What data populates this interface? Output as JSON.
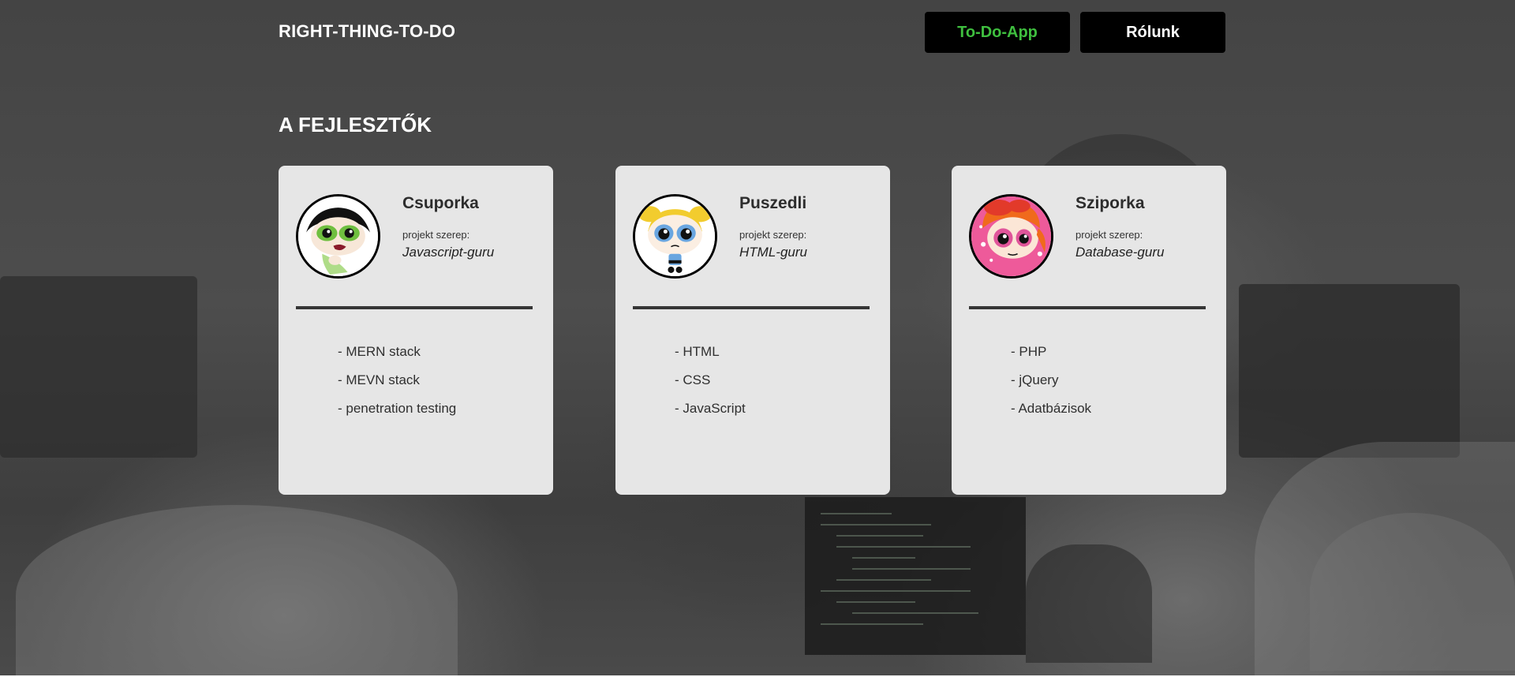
{
  "header": {
    "brand": "RIGHT-THING-TO-DO",
    "nav": [
      {
        "label": "To-Do-App",
        "color": "#3fbf3f"
      },
      {
        "label": "Rólunk",
        "color": "#ffffff"
      }
    ]
  },
  "section": {
    "title": "A FEJLESZTŐK"
  },
  "developers": [
    {
      "name": "Csuporka",
      "role_label": "projekt szerep:",
      "role": "Javascript-guru",
      "avatar_icon": "buttercup-avatar-icon",
      "skills": [
        "- MERN stack",
        "- MEVN stack",
        "- penetration testing"
      ]
    },
    {
      "name": "Puszedli",
      "role_label": "projekt szerep:",
      "role": "HTML-guru",
      "avatar_icon": "bubbles-avatar-icon",
      "skills": [
        "- HTML",
        "- CSS",
        "- JavaScript"
      ]
    },
    {
      "name": "Sziporka",
      "role_label": "projekt szerep:",
      "role": "Database-guru",
      "avatar_icon": "blossom-avatar-icon",
      "skills": [
        "- PHP",
        "- jQuery",
        "- Adatbázisok"
      ]
    }
  ],
  "colors": {
    "card_background": "#e6e6e6",
    "nav_button_background": "#000000",
    "accent_green": "#3fbf3f"
  }
}
